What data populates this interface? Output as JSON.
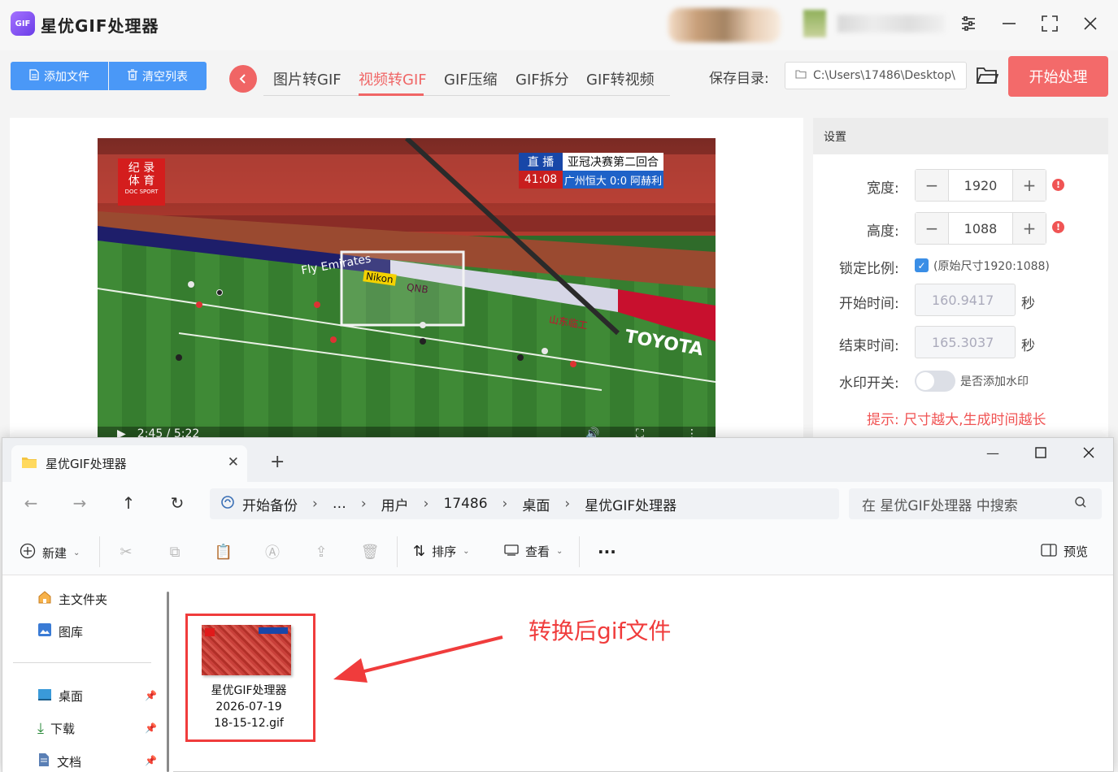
{
  "app": {
    "title": "星优GIF处理器",
    "logo_text": "GIF",
    "toolbar": {
      "add_file": "添加文件",
      "clear_list": "清空列表"
    },
    "tabs": [
      "图片转GIF",
      "视频转GIF",
      "GIF压缩",
      "GIF拆分",
      "GIF转视频"
    ],
    "active_tab": "视频转GIF",
    "save_dir_label": "保存目录:",
    "save_dir_path": "C:\\Users\\17486\\Desktop\\",
    "start_button": "开始处理",
    "video": {
      "live_label": "直 播",
      "match_title": "亚冠决赛第二回合",
      "clock": "41:08",
      "score": "广州恒大 0:0 阿赫利",
      "channel_line1": "纪 录",
      "channel_line2": "体 育",
      "channel_line3": "DOC SPORT",
      "player_time": "2:45 / 5:22",
      "ad_boards": [
        "Fly Emirates",
        "Nikon",
        "QNB",
        "山东临工",
        "TOYOTA"
      ]
    },
    "settings": {
      "header": "设置",
      "width_label": "宽度:",
      "width_value": "1920",
      "height_label": "高度:",
      "height_value": "1088",
      "lock_label": "锁定比例:",
      "lock_checked": true,
      "lock_note": "(原始尺寸1920:1088)",
      "start_label": "开始时间:",
      "start_value": "160.9417",
      "end_label": "结束时间:",
      "end_value": "165.3037",
      "seconds_unit": "秒",
      "watermark_label": "水印开关:",
      "watermark_note": "是否添加水印",
      "watermark_on": false,
      "tip": "提示: 尺寸越大,生成时间越长"
    }
  },
  "explorer": {
    "tab_title": "星优GIF处理器",
    "breadcrumb": [
      "开始备份",
      "…",
      "用户",
      "17486",
      "桌面",
      "星优GIF处理器"
    ],
    "search_placeholder": "在 星优GIF处理器 中搜索",
    "commands": {
      "new": "新建",
      "sort": "排序",
      "view": "查看",
      "more": "...",
      "preview": "预览"
    },
    "nav": {
      "home": "主文件夹",
      "gallery": "图库",
      "desktop": "桌面",
      "downloads": "下载",
      "documents": "文档"
    },
    "file": {
      "line1": "星优GIF处理器",
      "line2": "2026-07-19",
      "line3": "18-15-12.gif"
    },
    "annotation": "转换后gif文件"
  },
  "colors": {
    "accent_red": "#f06565",
    "button_blue": "#4a98f7",
    "annotation_red": "#f03c3c"
  }
}
